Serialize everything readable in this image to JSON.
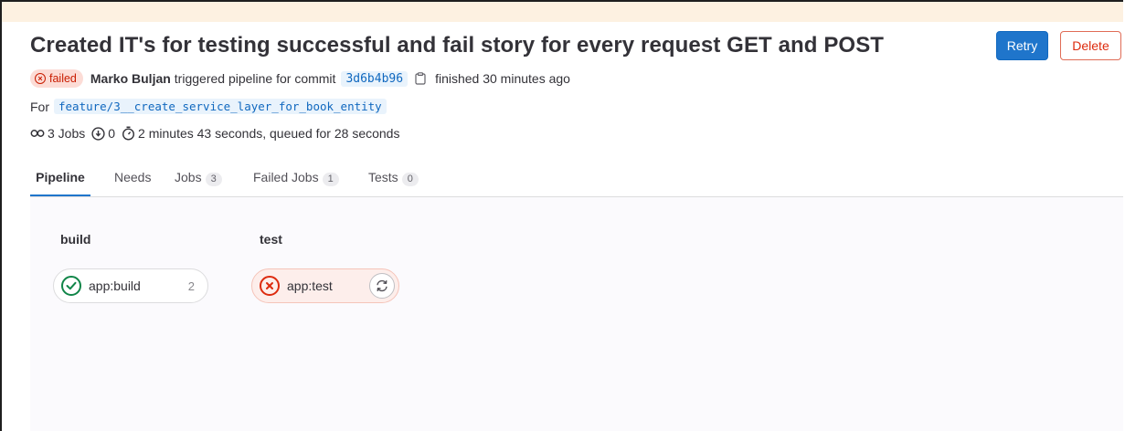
{
  "header": {
    "title": "Created IT's for testing successful and fail story for every request GET and POST",
    "retry_label": "Retry",
    "delete_label": "Delete"
  },
  "meta": {
    "status": "failed",
    "user": "Marko Buljan",
    "triggered_text": "triggered pipeline for commit",
    "commit_sha": "3d6b4b96",
    "finished_text": "finished 30 minutes ago",
    "for_label": "For",
    "branch": "feature/3__create_service_layer_for_book_entity"
  },
  "stats": {
    "jobs": "3 Jobs",
    "info_count": "0",
    "duration": "2 minutes 43 seconds, queued for 28 seconds"
  },
  "tabs": [
    {
      "label": "Pipeline",
      "active": true
    },
    {
      "label": "Needs"
    },
    {
      "label": "Jobs",
      "count": "3"
    },
    {
      "label": "Failed Jobs",
      "count": "1"
    },
    {
      "label": "Tests",
      "count": "0"
    }
  ],
  "stages": [
    {
      "name": "build",
      "jobs": [
        {
          "name": "app:build",
          "status": "success",
          "count": "2"
        }
      ]
    },
    {
      "name": "test",
      "jobs": [
        {
          "name": "app:test",
          "status": "failed"
        }
      ]
    }
  ],
  "colors": {
    "primary": "#1f75cb",
    "danger": "#dd2b0e",
    "success": "#108548",
    "failed_bg": "#fcdcd6"
  },
  "icons": {
    "status": "status-failed-icon",
    "copy": "clipboard-icon",
    "jobs": "pipeline-icon",
    "info": "info-icon",
    "timer": "timer-icon",
    "job_success": "status-success-icon",
    "job_failed": "status-failed-icon",
    "retry": "retry-icon"
  }
}
